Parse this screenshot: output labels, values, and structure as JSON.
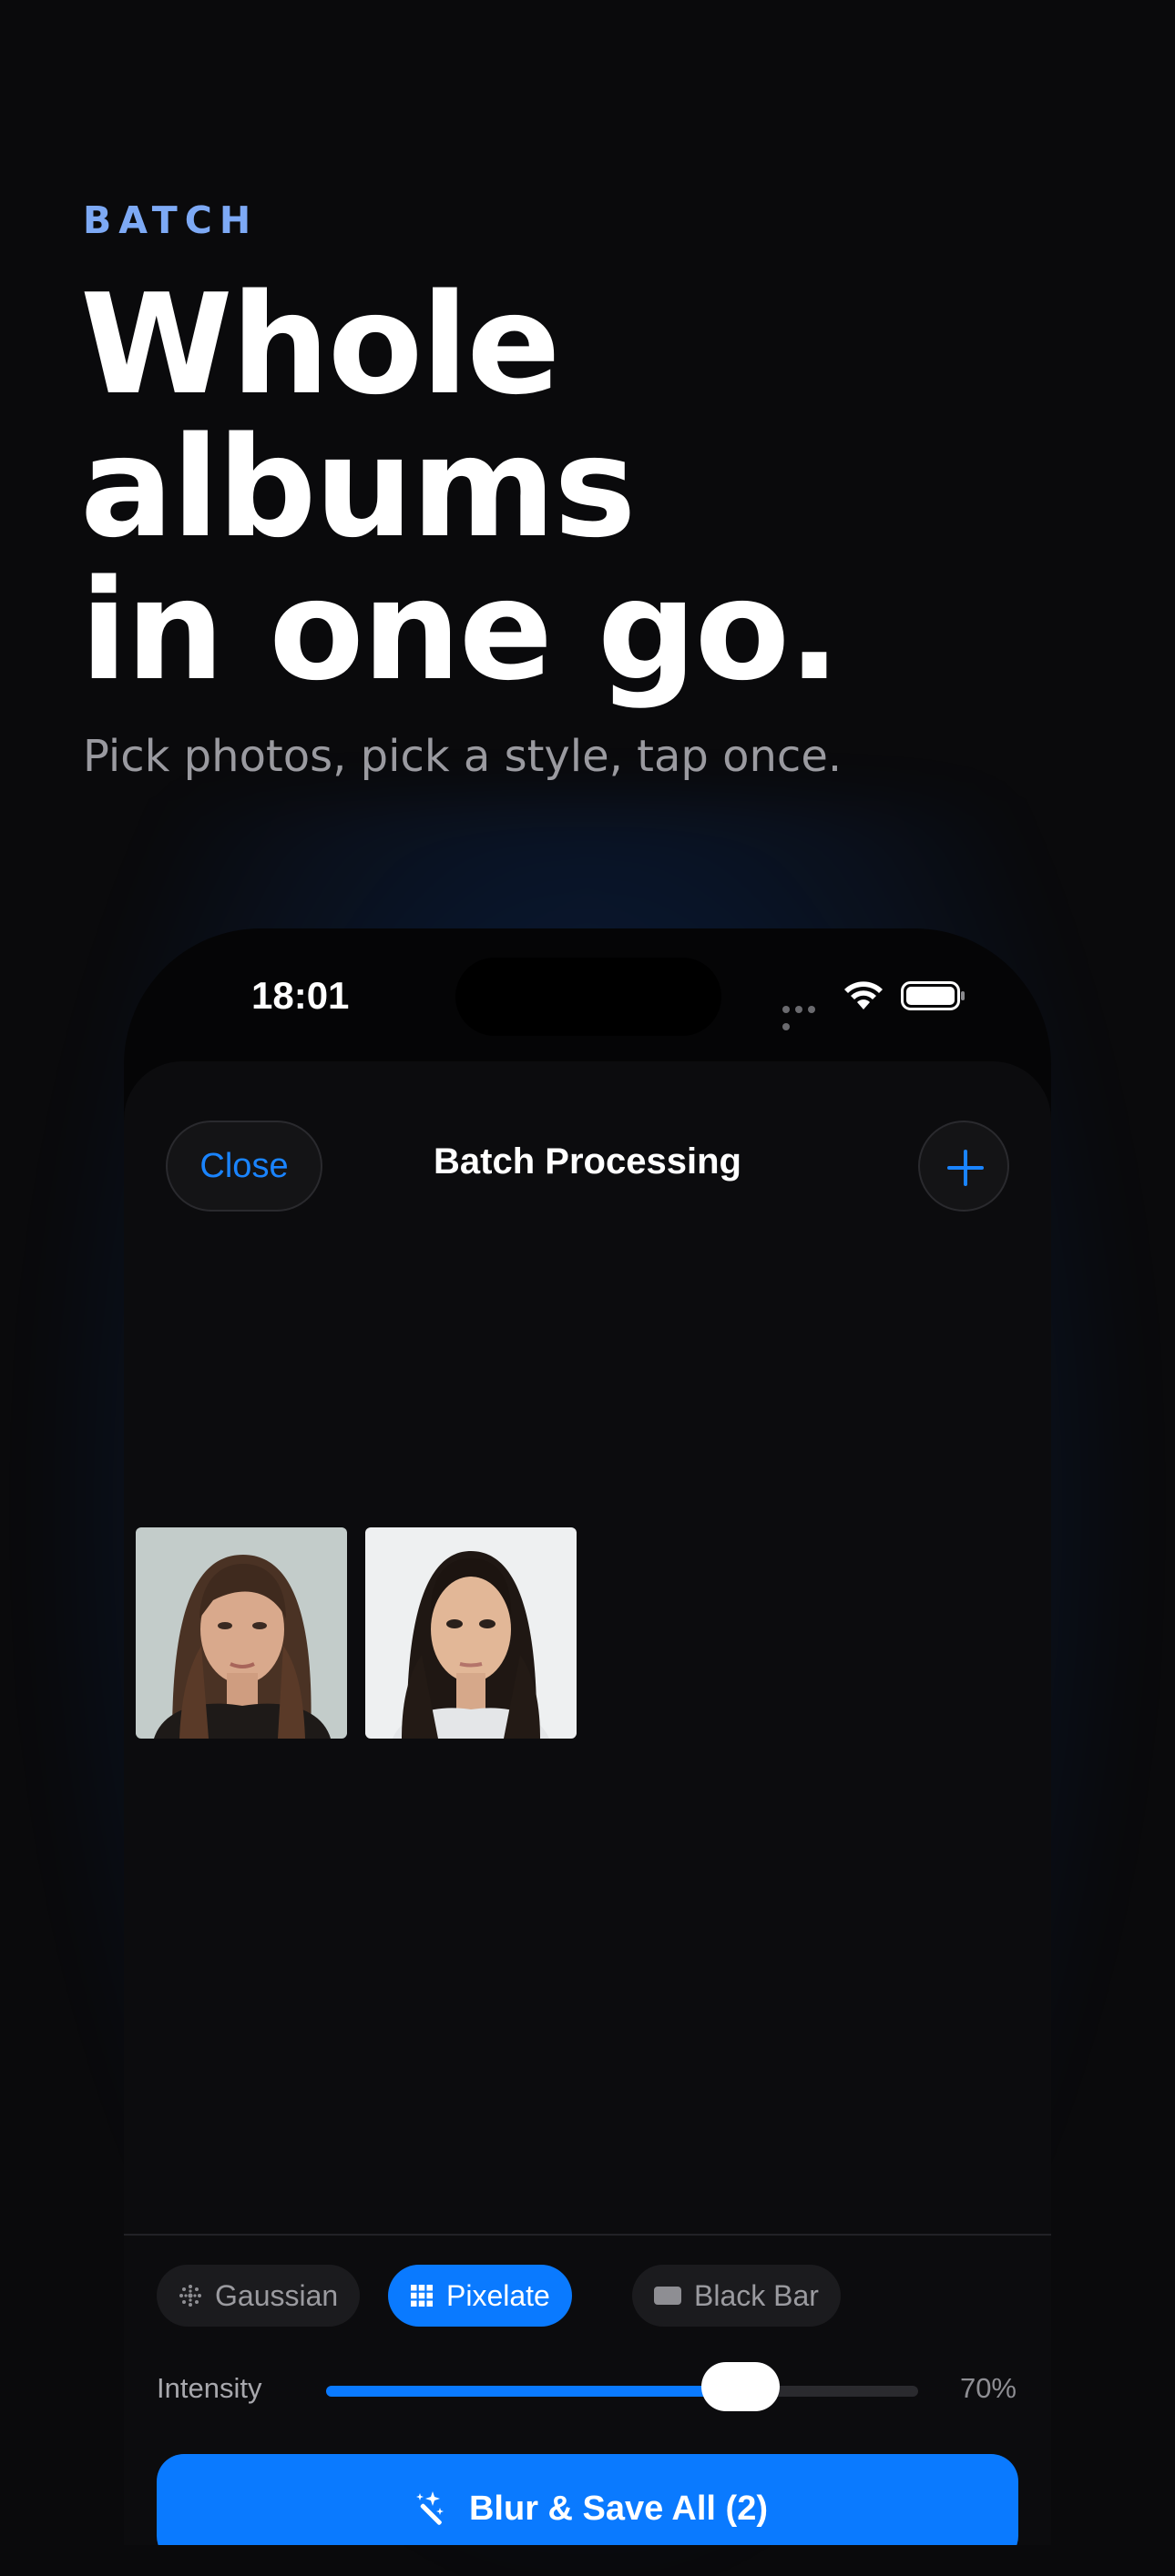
{
  "hero": {
    "eyebrow": "BATCH",
    "headline_lines": [
      "Whole",
      "albums",
      "in one go."
    ],
    "subtitle": "Pick photos, pick a style, tap once."
  },
  "status_bar": {
    "time": "18:01",
    "icons": [
      "cellular-icon",
      "wifi-icon",
      "battery-icon"
    ]
  },
  "nav": {
    "close_label": "Close",
    "title": "Batch Processing",
    "add_icon": "plus-icon"
  },
  "photos": [
    {
      "description_icon": "photo-thumbnail"
    },
    {
      "description_icon": "photo-thumbnail"
    }
  ],
  "styles": {
    "options": [
      {
        "label": "Gaussian",
        "icon": "gaussian-dots-icon",
        "selected": false
      },
      {
        "label": "Pixelate",
        "icon": "grid-icon",
        "selected": true
      },
      {
        "label": "Black Bar",
        "icon": "black-bar-icon",
        "selected": false
      }
    ]
  },
  "intensity": {
    "label": "Intensity",
    "value_text": "70%",
    "value": 0.7
  },
  "action": {
    "label": "Blur & Save All (2)",
    "icon": "magic-wand-icon"
  },
  "colors": {
    "accent": "#0a7aff",
    "eyebrow": "#7da9f5",
    "background": "#0a0a0c"
  }
}
